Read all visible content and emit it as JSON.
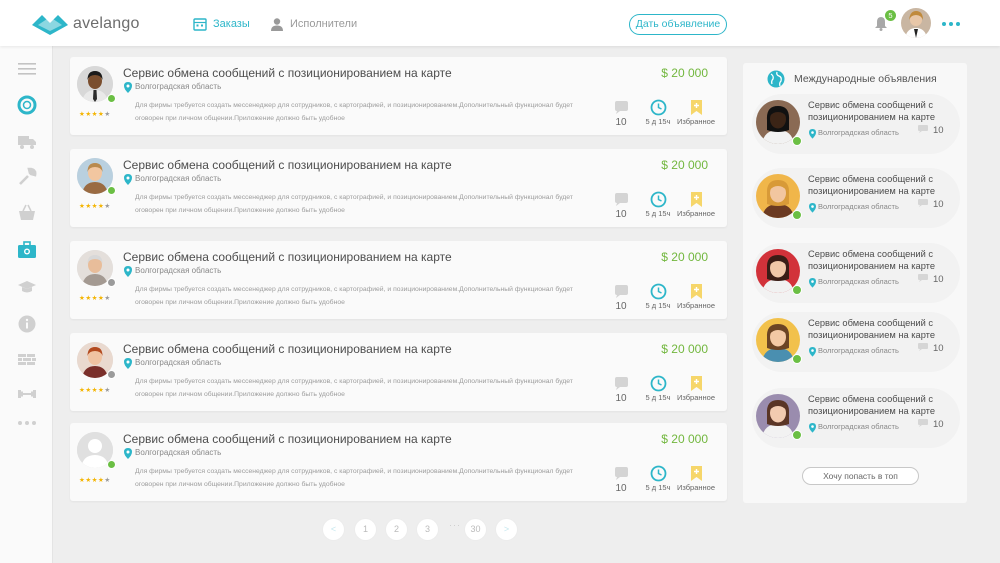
{
  "brand": {
    "name": "avelango",
    "accent": "#2db6c9",
    "price_color": "#72b73e",
    "online_color": "#6bbf44",
    "star_color": "#f4b400"
  },
  "nav": {
    "orders": "Заказы",
    "performers": "Исполнители"
  },
  "header": {
    "post_button": "Дать объявление",
    "notification_count": "5"
  },
  "sidebar": {
    "icons": [
      "menu-icon",
      "lifebuoy-icon",
      "truck-icon",
      "wrench-icon",
      "basket-icon",
      "briefcase-icon",
      "graduation-cap-icon",
      "info-icon",
      "bricks-icon",
      "dumbbell-icon",
      "more-icon"
    ],
    "active_index": 5
  },
  "orders": [
    {
      "title": "Сервис обмена сообщений с позиционированием на карте",
      "location": "Волгоградская область",
      "description": "Для фирмы требуется создать мессенеджер для сотрудников, с картографией, и позиционированием.Дополнительный функционал будет оговорен при личном общении.Приложение должно быть удобное",
      "price": "$ 20 000",
      "comments": "10",
      "time": "5 д 15ч",
      "fav_label": "Избранное",
      "rating": 4,
      "online": true
    },
    {
      "title": "Сервис обмена сообщений с позиционированием на карте",
      "location": "Волгоградская область",
      "description": "Для фирмы требуется создать мессенеджер для сотрудников, с картографией, и позиционированием.Дополнительный функционал будет оговорен при личном общении.Приложение должно быть удобное",
      "price": "$ 20 000",
      "comments": "10",
      "time": "5 д 15ч",
      "fav_label": "Избранное",
      "rating": 4,
      "online": true
    },
    {
      "title": "Сервис обмена сообщений с позиционированием на карте",
      "location": "Волгоградская область",
      "description": "Для фирмы требуется создать мессенеджер для сотрудников, с картографией, и позиционированием.Дополнительный функционал будет оговорен при личном общении.Приложение должно быть удобное",
      "price": "$ 20 000",
      "comments": "10",
      "time": "5 д 15ч",
      "fav_label": "Избранное",
      "rating": 4,
      "online": false
    },
    {
      "title": "Сервис обмена сообщений с позиционированием на карте",
      "location": "Волгоградская область",
      "description": "Для фирмы требуется создать мессенеджер для сотрудников, с картографией, и позиционированием.Дополнительный функционал будет оговорен при личном общении.Приложение должно быть удобное",
      "price": "$ 20 000",
      "comments": "10",
      "time": "5 д 15ч",
      "fav_label": "Избранное",
      "rating": 4,
      "online": false
    },
    {
      "title": "Сервис обмена сообщений с позиционированием на карте",
      "location": "Волгоградская область",
      "description": "Для фирмы требуется создать мессенеджер для сотрудников, с картографией, и позиционированием.Дополнительный функционал будет оговорен при личном общении.Приложение должно быть удобное",
      "price": "$ 20 000",
      "comments": "10",
      "time": "5 д 15ч",
      "fav_label": "Избранное",
      "rating": 4,
      "online": true
    }
  ],
  "international": {
    "title": "Международные объявления",
    "items": [
      {
        "title": "Сервис обмена сообщений с позиционированием на карте",
        "location": "Волгоградская область",
        "comments": "10"
      },
      {
        "title": "Сервис обмена сообщений с позиционированием на карте",
        "location": "Волгоградская область",
        "comments": "10"
      },
      {
        "title": "Сервис обмена сообщений с позиционированием на карте",
        "location": "Волгоградская область",
        "comments": "10"
      },
      {
        "title": "Сервис обмена сообщений с позиционированием на карте",
        "location": "Волгоградская область",
        "comments": "10"
      },
      {
        "title": "Сервис обмена сообщений с позиционированием на карте",
        "location": "Волгоградская область",
        "comments": "10"
      }
    ],
    "top_button": "Хочу попасть в топ"
  },
  "pagination": {
    "prev": "<",
    "pages": [
      "1",
      "2",
      "3"
    ],
    "ellipsis": "···",
    "last": "30",
    "next": ">"
  }
}
